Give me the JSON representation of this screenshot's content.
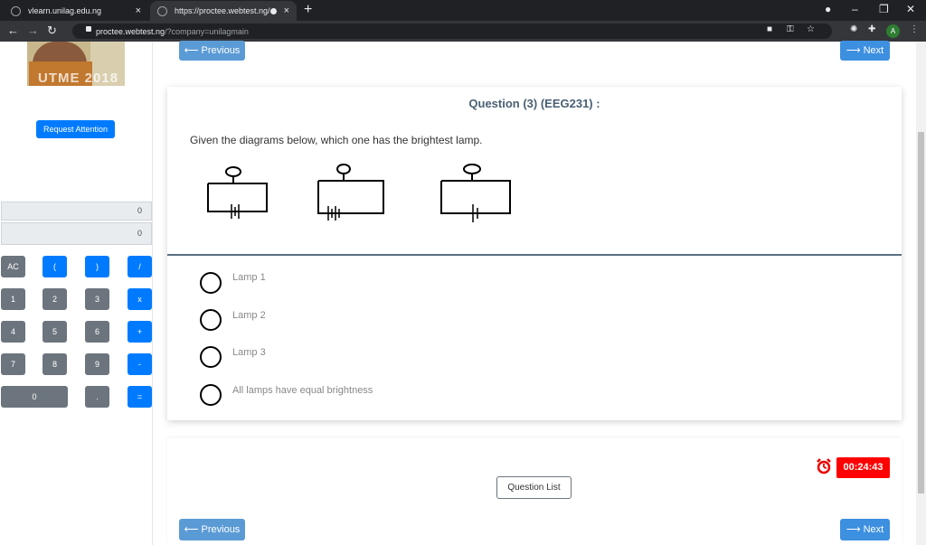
{
  "browser": {
    "tabs": [
      {
        "title": "vlearn.unilag.edu.ng",
        "close": "×"
      },
      {
        "title": "https://proctee.webtest.ng/?c",
        "close": "×"
      }
    ],
    "new_tab": "+",
    "window_controls": {
      "minimize": "–",
      "restore": "❐",
      "close": "✕"
    },
    "nav": {
      "back": "←",
      "forward": "→",
      "reload": "↻"
    },
    "url_host": "proctee.webtest.ng",
    "url_path": "/?company=unilagmain",
    "profile_initial": "A"
  },
  "sidebar": {
    "webcam_watermark": "UTME 2018",
    "request_attention": "Request Attention",
    "calculator": {
      "display_top": "0",
      "display_bottom": "0",
      "keys": [
        "AC",
        "(",
        ")",
        "/",
        "1",
        "2",
        "3",
        "x",
        "4",
        "5",
        "6",
        "+",
        "7",
        "8",
        "9",
        "-",
        "0",
        ".",
        "="
      ]
    }
  },
  "main": {
    "previous_label": "⟵ Previous",
    "next_label": "⟶ Next",
    "question_title": "Question (3) (EEG231) :",
    "question_text": "Given the diagrams below, which one has the brightest lamp.",
    "options": [
      "Lamp 1",
      "Lamp 2",
      "Lamp 3",
      "All lamps have equal brightness"
    ],
    "question_list": "Question List",
    "timer": "00:24:43"
  },
  "colors": {
    "primary": "#007bff",
    "nav_button": "#5b9bd5",
    "timer": "#ff0000",
    "title": "#4a6073"
  }
}
